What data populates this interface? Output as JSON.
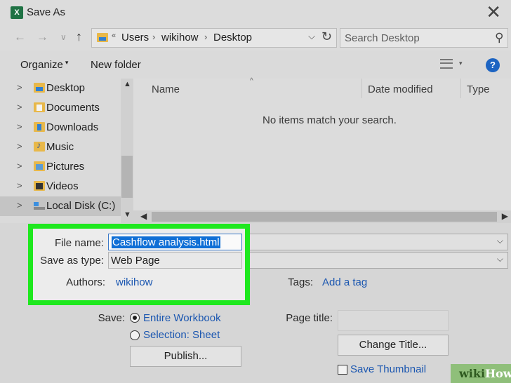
{
  "window": {
    "title": "Save As",
    "app_icon_letter": "X",
    "close_glyph": "✕"
  },
  "nav": {
    "back_glyph": "←",
    "forward_glyph": "→",
    "recent_glyph": "∨",
    "up_glyph": "↑",
    "breadcrumb": [
      "Users",
      "wikihow",
      "Desktop"
    ],
    "breadcrumb_sep": "›",
    "search_placeholder": "Search Desktop"
  },
  "toolbar": {
    "organize_label": "Organize",
    "new_folder_label": "New folder",
    "help_label": "?"
  },
  "sidebar": {
    "items": [
      {
        "label": "Desktop",
        "icon": "desktop-folder-icon"
      },
      {
        "label": "Documents",
        "icon": "documents-folder-icon"
      },
      {
        "label": "Downloads",
        "icon": "downloads-folder-icon"
      },
      {
        "label": "Music",
        "icon": "music-folder-icon"
      },
      {
        "label": "Pictures",
        "icon": "pictures-folder-icon"
      },
      {
        "label": "Videos",
        "icon": "videos-folder-icon"
      },
      {
        "label": "Local Disk (C:)",
        "icon": "local-disk-icon",
        "selected": true
      }
    ]
  },
  "filelist": {
    "columns": [
      "Name",
      "Date modified",
      "Type"
    ],
    "empty_message": "No items match your search."
  },
  "form": {
    "file_name_label": "File name:",
    "file_name_value": "Cashflow analysis.html",
    "save_as_type_label": "Save as type:",
    "save_as_type_value": "Web Page",
    "authors_label": "Authors:",
    "authors_value": "wikihow",
    "tags_label": "Tags:",
    "tags_value": "Add a tag",
    "save_label": "Save:",
    "save_options": [
      "Entire Workbook",
      "Selection: Sheet"
    ],
    "publish_label": "Publish...",
    "page_title_label": "Page title:",
    "change_title_label": "Change Title...",
    "save_thumbnail_label": "Save Thumbnail"
  },
  "watermark": {
    "part1": "wiki",
    "part2": "How"
  },
  "colors": {
    "highlight": "#1ee81e",
    "link": "#1a56b0",
    "selection": "#0f6fd6"
  }
}
